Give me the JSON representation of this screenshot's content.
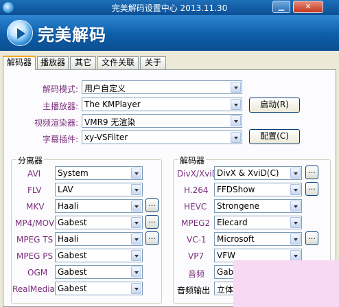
{
  "window": {
    "title": "完美解码设置中心 2013.11.30",
    "min_symbol": "▁",
    "close_symbol": "✕",
    "app_icon": "player-logo-icon"
  },
  "banner": {
    "brand": "完美解码",
    "logo_icon": "play-disc-logo-icon"
  },
  "tabs": [
    {
      "label": "解码器",
      "active": true
    },
    {
      "label": "播放器",
      "active": false
    },
    {
      "label": "其它",
      "active": false
    },
    {
      "label": "文件关联",
      "active": false
    },
    {
      "label": "关于",
      "active": false
    }
  ],
  "top": {
    "decode_mode": {
      "label": "解码模式:",
      "value": "用户自定义"
    },
    "main_player": {
      "label": "主播放器:",
      "value": "The KMPlayer"
    },
    "video_renderer": {
      "label": "视频渲染器:",
      "value": "VMR9 无渲染"
    },
    "subtitle_plugin": {
      "label": "字幕插件:",
      "value": "xy-VSFilter"
    },
    "launch_button": "启动(R)",
    "configure_button": "配置(C)"
  },
  "splitter_group": {
    "title": "分离器",
    "dots_label": "...",
    "rows": [
      {
        "label": "AVI",
        "value": "System",
        "has_dots": false
      },
      {
        "label": "FLV",
        "value": "LAV",
        "has_dots": false
      },
      {
        "label": "MKV",
        "value": "Haali",
        "has_dots": true
      },
      {
        "label": "MP4/MOV",
        "value": "Gabest",
        "has_dots": true
      },
      {
        "label": "MPEG TS",
        "value": "Haali",
        "has_dots": true
      },
      {
        "label": "MPEG PS",
        "value": "Gabest",
        "has_dots": false
      },
      {
        "label": "OGM",
        "value": "Gabest",
        "has_dots": false
      },
      {
        "label": "RealMedia",
        "value": "Gabest",
        "has_dots": false
      }
    ]
  },
  "decoder_group": {
    "title": "解码器",
    "dots_label": "...",
    "rows": [
      {
        "label": "DivX/XviD",
        "value": "DivX & XviD(C)",
        "has_dots": true
      },
      {
        "label": "H.264",
        "value": "FFDShow",
        "has_dots": true
      },
      {
        "label": "HEVC",
        "value": "Strongene",
        "has_dots": false
      },
      {
        "label": "MPEG2",
        "value": "Elecard",
        "has_dots": false
      },
      {
        "label": "VC-1",
        "value": "Microsoft",
        "has_dots": true
      },
      {
        "label": "VP7",
        "value": "VFW",
        "has_dots": false
      },
      {
        "label": "音频",
        "value": "Gabe",
        "has_dots": false
      },
      {
        "label": "音频输出",
        "value": "立体",
        "has_dots": false
      }
    ]
  },
  "colors": {
    "titlebar": "#0c4f95",
    "banner": "#0d5ea8",
    "label_purple": "#7b2d7b",
    "active_tab_accent": "#f5a623",
    "overlay_pink": "#f7d9f4"
  }
}
